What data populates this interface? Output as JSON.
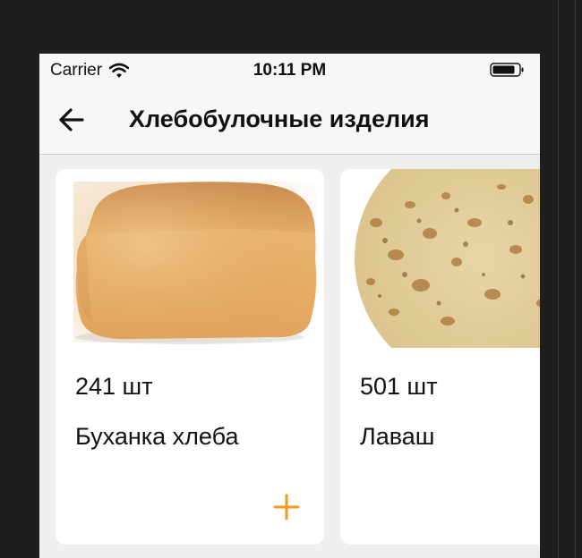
{
  "status_bar": {
    "carrier": "Carrier",
    "time": "10:11 PM",
    "icons": [
      "wifi-icon",
      "battery-icon"
    ]
  },
  "nav": {
    "back_icon": "arrow-left-icon",
    "title": "Хлебобулочные изделия"
  },
  "products": [
    {
      "quantity": "241 шт",
      "name": "Буханка хлеба",
      "image": "bread-loaf-image",
      "add_icon": "plus-icon"
    },
    {
      "quantity": "501 шт",
      "name": "Лаваш",
      "image": "lavash-image"
    }
  ],
  "colors": {
    "accent": "#f39a1e",
    "background": "#efefef",
    "card": "#ffffff",
    "bar": "#f7f7f7",
    "outer": "#1e1e1e"
  }
}
